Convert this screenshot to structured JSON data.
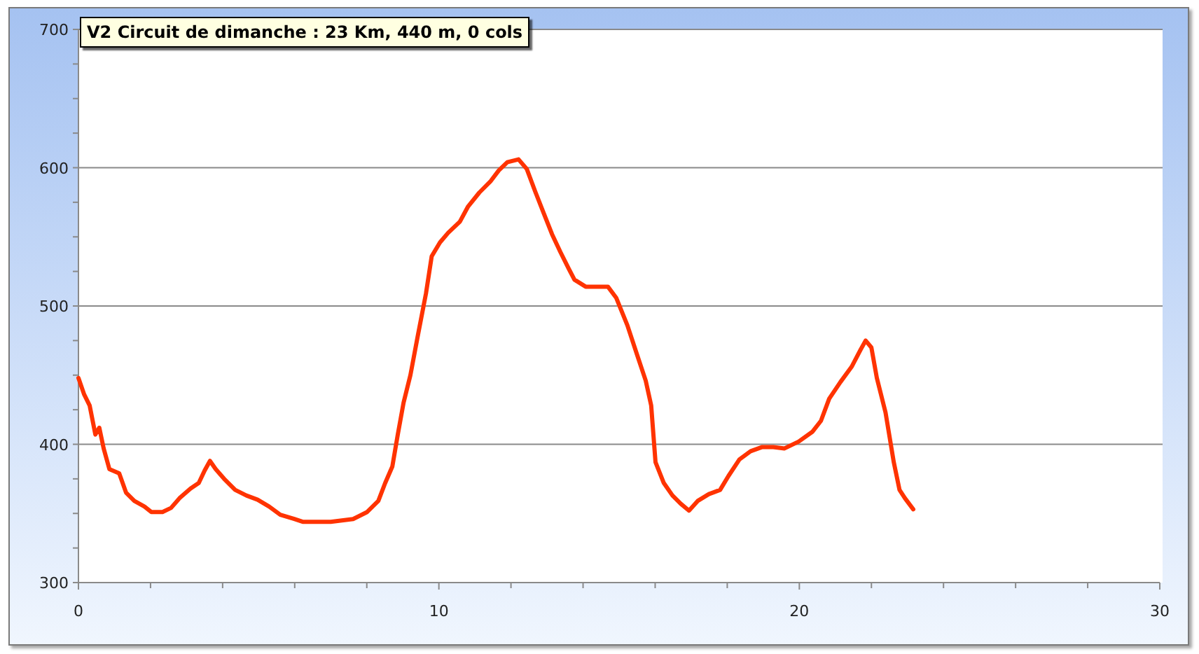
{
  "title": "V2 Circuit de dimanche : 23 Km, 440 m, 0 cols",
  "chart_data": {
    "type": "line",
    "grid": true,
    "xlim": [
      0,
      30
    ],
    "ylim": [
      300,
      700
    ],
    "xticks": [
      0,
      10,
      20,
      30
    ],
    "yticks": [
      300,
      400,
      500,
      600,
      700
    ],
    "x": [
      0,
      0.16,
      0.31,
      0.47,
      0.58,
      0.7,
      0.86,
      1.13,
      1.32,
      1.55,
      1.83,
      2.02,
      2.33,
      2.57,
      2.8,
      3.11,
      3.34,
      3.5,
      3.65,
      3.81,
      4.04,
      4.35,
      4.66,
      4.97,
      5.29,
      5.6,
      5.99,
      6.22,
      7,
      7.62,
      8.01,
      8.32,
      8.51,
      8.71,
      8.86,
      9.02,
      9.21,
      9.41,
      9.64,
      9.8,
      10.03,
      10.26,
      10.58,
      10.81,
      11.12,
      11.43,
      11.66,
      11.9,
      12.21,
      12.44,
      12.67,
      12.91,
      13.14,
      13.37,
      13.6,
      13.76,
      14.07,
      14.38,
      14.69,
      14.92,
      15.23,
      15.51,
      15.74,
      15.89,
      16.01,
      16.24,
      16.48,
      16.71,
      16.94,
      17.18,
      17.49,
      17.8,
      18.03,
      18.34,
      18.65,
      18.97,
      19.28,
      19.59,
      19.98,
      20.36,
      20.6,
      20.83,
      21.14,
      21.45,
      21.69,
      21.84,
      22,
      22.15,
      22.39,
      22.62,
      22.78,
      22.93,
      23.16
    ],
    "series": [
      {
        "color": "#ff3300",
        "values": [
          448,
          436,
          428,
          407,
          412,
          397,
          382,
          379,
          365,
          359,
          355,
          351,
          351,
          354,
          361,
          368,
          372,
          381,
          388,
          382,
          375,
          367,
          363,
          360,
          355,
          349,
          346,
          344,
          344,
          346,
          351,
          359,
          372,
          384,
          407,
          430,
          450,
          478,
          509,
          536,
          546,
          553,
          561,
          572,
          582,
          590,
          598,
          604,
          606,
          599,
          583,
          567,
          552,
          539,
          527,
          519,
          514,
          514,
          514,
          506,
          486,
          464,
          446,
          428,
          387,
          372,
          363,
          357,
          352,
          359,
          364,
          367,
          377,
          389,
          395,
          398,
          398,
          397,
          402,
          409,
          417,
          433,
          445,
          456,
          468,
          475,
          470,
          448,
          423,
          387,
          367,
          361,
          353
        ]
      }
    ]
  }
}
